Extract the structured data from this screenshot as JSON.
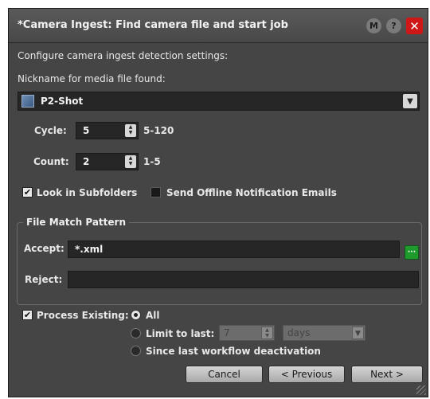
{
  "dialog": {
    "title": "*Camera Ingest: Find camera file and start job",
    "buttons": {
      "minimize": "M",
      "help": "?",
      "close": "✕"
    },
    "intro": "Configure camera ingest detection settings:",
    "nickname_label": "Nickname for media file found:",
    "nickname_value": "P2-Shot",
    "cycle": {
      "label": "Cycle:",
      "value": "5",
      "range": "5-120"
    },
    "count": {
      "label": "Count:",
      "value": "2",
      "range": "1-5"
    },
    "look_in_subfolders": {
      "label": "Look in Subfolders",
      "checked": true
    },
    "send_offline": {
      "label": "Send Offline Notification Emails",
      "checked": false
    },
    "file_match": {
      "title": "File Match Pattern",
      "accept_label": "Accept:",
      "accept_value": "*.xml",
      "browse_label": "···",
      "reject_label": "Reject:",
      "reject_value": ""
    },
    "process_existing": {
      "label": "Process Existing:",
      "checked": true,
      "options": {
        "all": "All",
        "limit": "Limit to last:",
        "since": "Since last workflow deactivation"
      },
      "selected": "all",
      "limit_value": "7",
      "limit_unit": "days"
    },
    "footer": {
      "cancel": "Cancel",
      "previous": "< Previous",
      "next": "Next >"
    }
  }
}
